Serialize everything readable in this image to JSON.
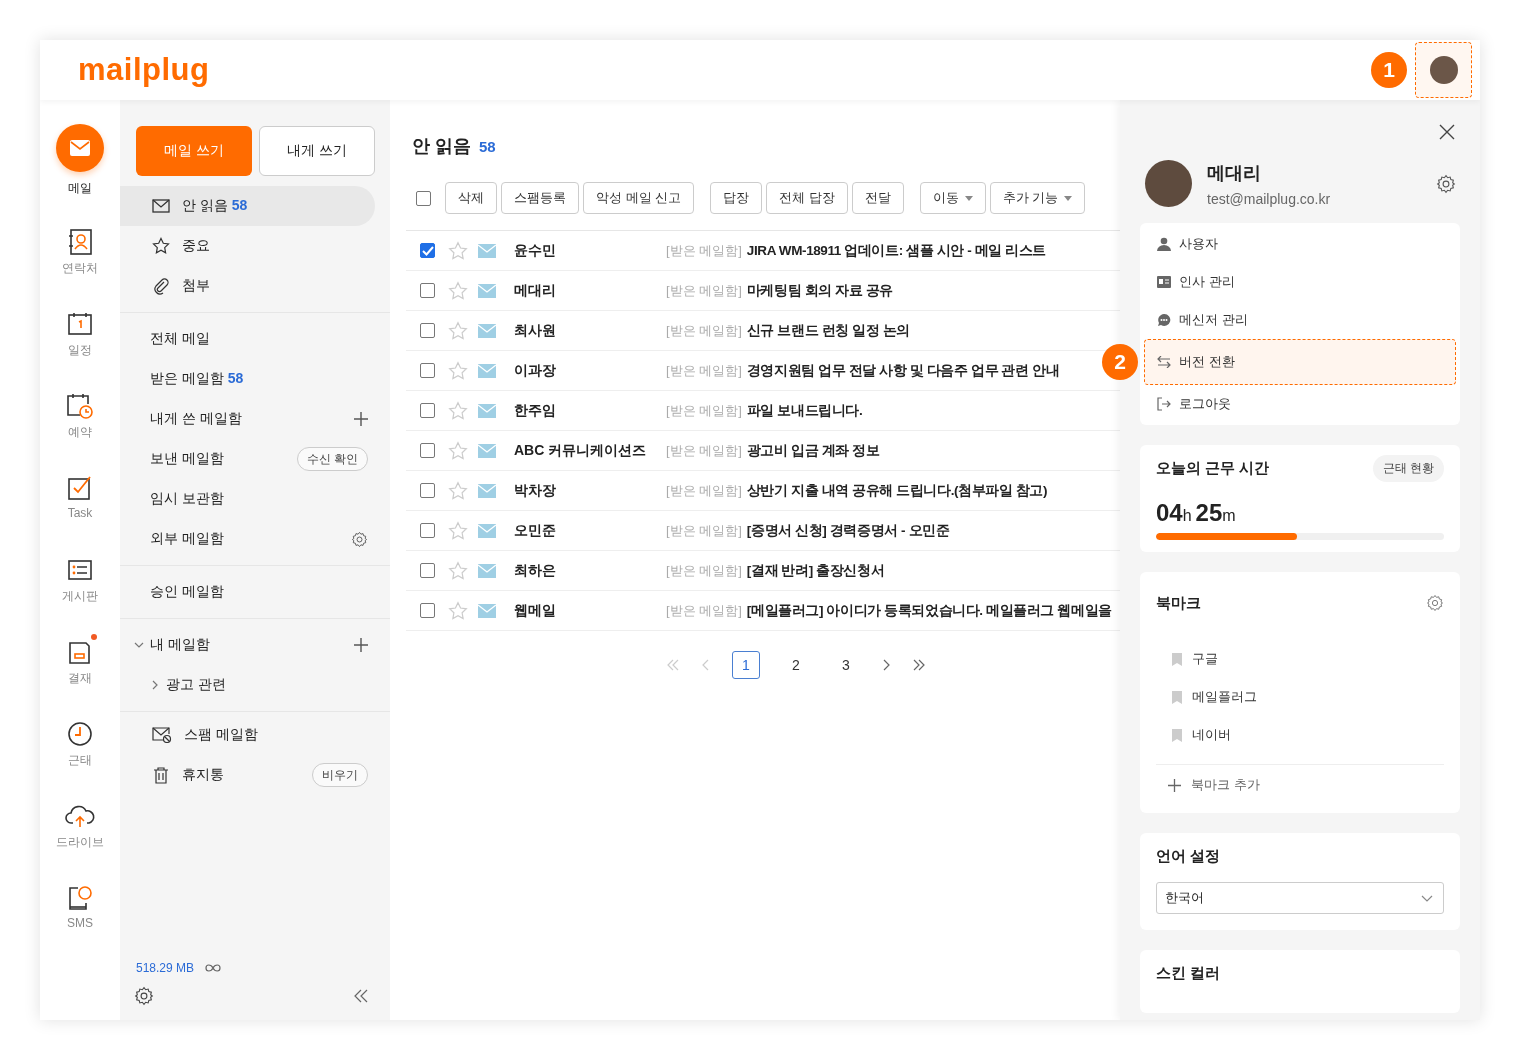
{
  "header": {
    "logo": "mailplug",
    "callout": "1"
  },
  "rail": [
    {
      "label": "메일",
      "selected": true,
      "notified": false
    },
    {
      "label": "연락처",
      "selected": false,
      "notified": false
    },
    {
      "label": "일정",
      "selected": false,
      "notified": false
    },
    {
      "label": "예약",
      "selected": false,
      "notified": false
    },
    {
      "label": "Task",
      "selected": false,
      "notified": false
    },
    {
      "label": "게시판",
      "selected": false,
      "notified": false
    },
    {
      "label": "결재",
      "selected": false,
      "notified": true
    },
    {
      "label": "근태",
      "selected": false,
      "notified": false
    },
    {
      "label": "드라이브",
      "selected": false,
      "notified": false
    },
    {
      "label": "SMS",
      "selected": false,
      "notified": false
    }
  ],
  "compose": {
    "primary": "메일 쓰기",
    "secondary": "내게 쓰기"
  },
  "folders": {
    "quick": [
      {
        "label": "안 읽음",
        "count": "58",
        "selected": true
      },
      {
        "label": "중요",
        "selected": false
      },
      {
        "label": "첨부",
        "selected": false
      }
    ],
    "mailboxes": [
      {
        "label": "전체 메일",
        "kind": "plain"
      },
      {
        "label": "받은 메일함",
        "count": "58",
        "kind": "plain"
      },
      {
        "label": "내게 쓴 메일함",
        "kind": "add"
      },
      {
        "label": "보낸 메일함",
        "button": "수신 확인",
        "kind": "button"
      },
      {
        "label": "임시 보관함",
        "kind": "plain"
      },
      {
        "label": "외부 메일함",
        "kind": "settings"
      }
    ],
    "approval": [
      {
        "label": "승인 메일함"
      }
    ],
    "my": {
      "label": "내 메일함",
      "expanded": true,
      "kind": "add",
      "children": [
        {
          "label": "광고 관련",
          "expanded": false
        }
      ]
    },
    "system": [
      {
        "label": "스팸 메일함"
      },
      {
        "label": "휴지통",
        "button": "비우기"
      }
    ],
    "storage": "518.29 MB"
  },
  "list": {
    "title": "안 읽음",
    "count": "58",
    "select_all": false,
    "toolbar": [
      [
        {
          "label": "삭제",
          "dropdown": false
        },
        {
          "label": "스팸등록",
          "dropdown": false
        },
        {
          "label": "악성 메일 신고",
          "dropdown": false
        }
      ],
      [
        {
          "label": "답장",
          "dropdown": false
        },
        {
          "label": "전체 답장",
          "dropdown": false
        },
        {
          "label": "전달",
          "dropdown": false
        }
      ],
      [
        {
          "label": "이동",
          "dropdown": true
        },
        {
          "label": "추가 기능",
          "dropdown": true
        }
      ]
    ],
    "rows": [
      {
        "checked": true,
        "starred": false,
        "sender": "윤수민",
        "folder": "[받은 메일함]",
        "subject": "JIRA WM-18911 업데이트: 샘플 시안 - 메일 리스트"
      },
      {
        "checked": false,
        "starred": false,
        "sender": "메대리",
        "folder": "[받은 메일함]",
        "subject": "마케팅팀 회의 자료 공유"
      },
      {
        "checked": false,
        "starred": false,
        "sender": "최사원",
        "folder": "[받은 메일함]",
        "subject": "신규 브랜드 런칭 일정 논의"
      },
      {
        "checked": false,
        "starred": false,
        "sender": "이과장",
        "folder": "[받은 메일함]",
        "subject": "경영지원팀 업무 전달 사항 및 다음주 업무 관련 안내"
      },
      {
        "checked": false,
        "starred": false,
        "sender": "한주임",
        "folder": "[받은 메일함]",
        "subject": "파일 보내드립니다."
      },
      {
        "checked": false,
        "starred": false,
        "sender": "ABC 커뮤니케이션즈",
        "folder": "[받은 메일함]",
        "subject": "광고비 입금 계좌 정보"
      },
      {
        "checked": false,
        "starred": false,
        "sender": "박차장",
        "folder": "[받은 메일함]",
        "subject": "상반기 지출 내역 공유해 드립니다.(첨부파일 참고)"
      },
      {
        "checked": false,
        "starred": false,
        "sender": "오민준",
        "folder": "[받은 메일함]",
        "subject": "[증명서 신청] 경력증명서 - 오민준"
      },
      {
        "checked": false,
        "starred": false,
        "sender": "최하은",
        "folder": "[받은 메일함]",
        "subject": "[결재 반려] 출장신청서"
      },
      {
        "checked": false,
        "starred": false,
        "sender": "웹메일",
        "folder": "[받은 메일함]",
        "subject": "[메일플러그] 아이디가 등록되었습니다. 메일플러그 웹메일을"
      }
    ],
    "pages": [
      {
        "label": "1",
        "selected": true
      },
      {
        "label": "2",
        "selected": false
      },
      {
        "label": "3",
        "selected": false
      }
    ]
  },
  "panel": {
    "profile": {
      "name": "메대리",
      "email": "test@mailplug.co.kr"
    },
    "menu": [
      {
        "label": "사용자",
        "highlighted": false
      },
      {
        "label": "인사 관리",
        "highlighted": false
      },
      {
        "label": "메신저 관리",
        "highlighted": false
      },
      {
        "label": "버전 전환",
        "highlighted": true,
        "callout": "2"
      },
      {
        "label": "로그아웃",
        "highlighted": false
      }
    ],
    "work": {
      "title": "오늘의 근무 시간",
      "button": "근태 현황",
      "hours": "04",
      "hours_unit": "h",
      "minutes": "25",
      "minutes_unit": "m",
      "level": 0.49
    },
    "bookmarks": {
      "title": "북마크",
      "items": [
        "구글",
        "메일플러그",
        "네이버"
      ],
      "add": "북마크 추가"
    },
    "language": {
      "title": "언어 설정",
      "value": "한국어"
    },
    "skin": {
      "title": "스킨 컬러"
    }
  }
}
